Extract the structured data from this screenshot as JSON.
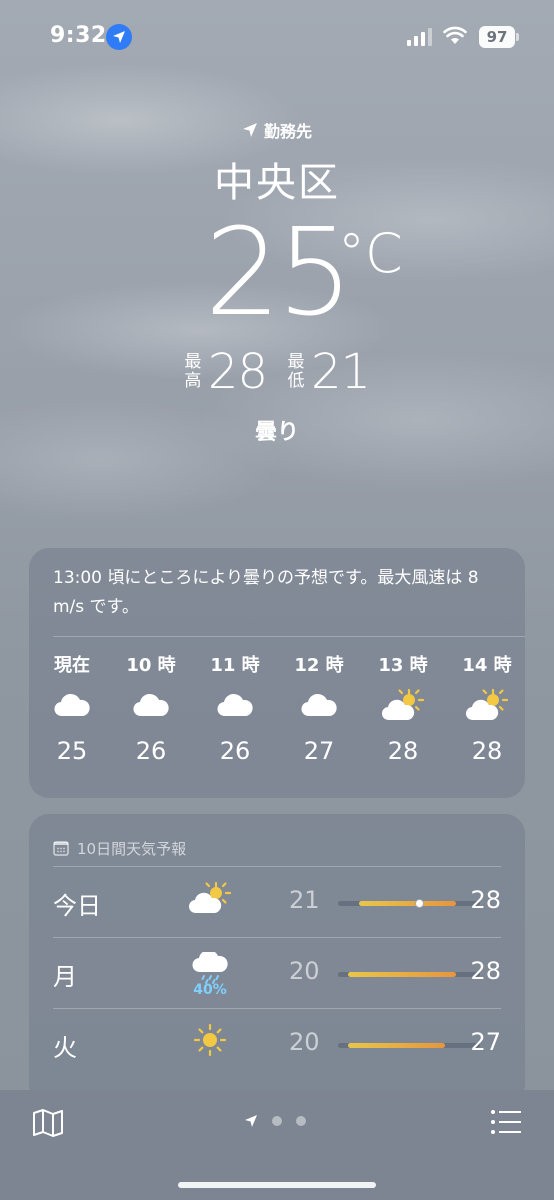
{
  "status_bar": {
    "time": "9:32",
    "battery": "97",
    "icons": [
      "location-arrow-icon",
      "signal-icon",
      "wifi-icon",
      "battery-icon"
    ]
  },
  "hero": {
    "location_label": "勤務先",
    "city": "中央区",
    "temperature": "25",
    "unit": "°C",
    "high_label": "最高",
    "high": "28",
    "low_label": "最低",
    "low": "21",
    "condition": "曇り"
  },
  "hourly": {
    "summary": "13:00 頃にところにより曇りの予想です。最大風速は 8 m/s です。",
    "hours": [
      {
        "label": "現在",
        "icon": "cloud-icon",
        "temp": "25"
      },
      {
        "label": "10 時",
        "icon": "cloud-icon",
        "temp": "26"
      },
      {
        "label": "11 時",
        "icon": "cloud-icon",
        "temp": "26"
      },
      {
        "label": "12 時",
        "icon": "cloud-icon",
        "temp": "27"
      },
      {
        "label": "13 時",
        "icon": "partly-sunny-icon",
        "temp": "28"
      },
      {
        "label": "14 時",
        "icon": "partly-sunny-icon",
        "temp": "28"
      }
    ]
  },
  "daily": {
    "header": "10日間天気予報",
    "days": [
      {
        "name": "今日",
        "icon": "partly-sunny-icon",
        "low": "21",
        "high": "28",
        "range_start": 0.15,
        "range_end": 0.83,
        "current": 0.57
      },
      {
        "name": "月",
        "icon": "rain-cloud-icon",
        "precip": "40%",
        "low": "20",
        "high": "28",
        "range_start": 0.07,
        "range_end": 0.83
      },
      {
        "name": "火",
        "icon": "sun-icon",
        "low": "20",
        "high": "27",
        "range_start": 0.07,
        "range_end": 0.75
      }
    ]
  },
  "colors": {
    "range_cool": "#e8c64a",
    "range_warm": "#e6963e",
    "precip": "#7fd0ff",
    "location_pill": "#2f7cf6"
  },
  "bottom_bar": {
    "icons": [
      "map-icon",
      "location-arrow-icon",
      "page-dot",
      "page-dot",
      "list-icon"
    ]
  }
}
